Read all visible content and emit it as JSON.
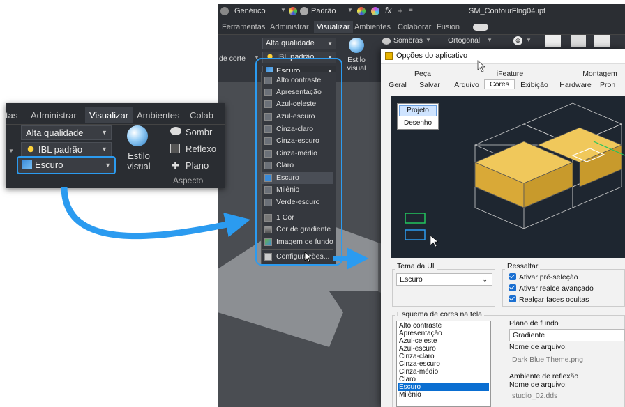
{
  "zoom": {
    "tabs": [
      "tas",
      "Administrar",
      "Visualizar",
      "Ambientes",
      "Colab"
    ],
    "quality": "Alta qualidade",
    "ibl": "IBL padrão",
    "style": "Escuro",
    "visual_style": "Estilo visual",
    "shadows": "Sombr",
    "reflex": "Reflexo",
    "plane": "Plano",
    "aspect": "Aspecto"
  },
  "titlebar": {
    "generic": "Genérico",
    "standard": "Padrão",
    "fx": "fx",
    "filename": "SM_ContourFlng04.ipt"
  },
  "ribbon": {
    "tabs": [
      "Ferramentas",
      "Administrar",
      "Visualizar",
      "Ambientes",
      "Colaborar",
      "Fusion"
    ],
    "quality": "Alta qualidade",
    "ibl": "IBL padrão",
    "section": "de corte",
    "visual_style": "Estilo visual",
    "shadows": "Sombras",
    "ortho": "Ortogonal",
    "style_current": "Escuro"
  },
  "menu": {
    "items": [
      "Alto contraste",
      "Apresentação",
      "Azul-celeste",
      "Azul-escuro",
      "Cinza-claro",
      "Cinza-escuro",
      "Cinza-médio",
      "Claro",
      "Escuro",
      "Milênio",
      "Verde-escuro"
    ],
    "selected": "Escuro",
    "bg_items": [
      "1 Cor",
      "Cor de gradiente",
      "Imagem de fundo"
    ],
    "settings": "Configurações..."
  },
  "dialog": {
    "title": "Opções do aplicativo",
    "tabs_row1": [
      "Peça",
      "iFeature",
      "Montagem"
    ],
    "tabs_row2": [
      "Geral",
      "Salvar",
      "Arquivo",
      "Cores",
      "Exibição",
      "Hardware",
      "Pron"
    ],
    "active_tab": "Cores",
    "preview_buttons": [
      "Projeto",
      "Desenho"
    ],
    "ui_theme_label": "Tema da UI",
    "ui_theme_value": "Escuro",
    "highlight_label": "Ressaltar",
    "checks": [
      "Ativar pré-seleção",
      "Ativar realce avançado",
      "Realçar faces ocultas"
    ],
    "scheme_label": "Esquema de cores na tela",
    "schemes": [
      "Alto contraste",
      "Apresentação",
      "Azul-celeste",
      "Azul-escuro",
      "Cinza-claro",
      "Cinza-escuro",
      "Cinza-médio",
      "Claro",
      "Escuro",
      "Milênio"
    ],
    "scheme_selected": "Escuro",
    "bg_label": "Plano de fundo",
    "bg_value": "Gradiente",
    "file_label": "Nome de arquivo:",
    "file_value": "Dark Blue Theme.png",
    "refl_label": "Ambiente de reflexão",
    "file_label2": "Nome de arquivo:",
    "refl_value": "studio_02.dds"
  },
  "colors": {
    "accent": "#2b9bf0",
    "cube": "#e3b64a",
    "selection": "#0a6ed1"
  }
}
